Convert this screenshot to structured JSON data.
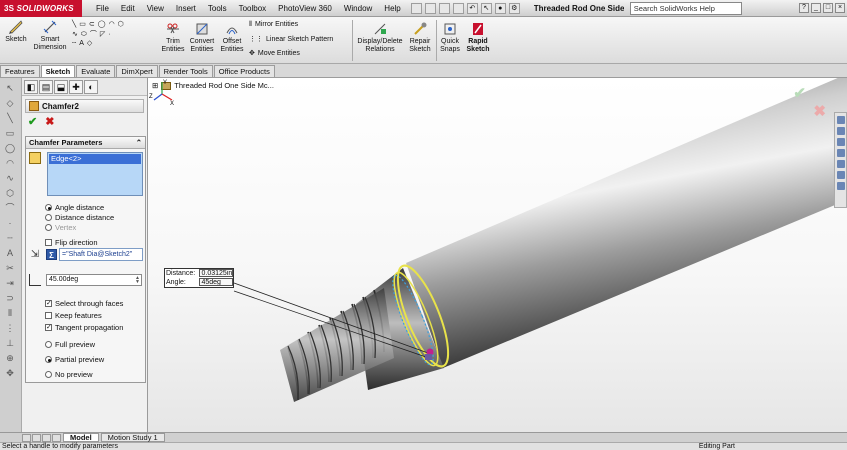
{
  "app": {
    "brand": "SOLIDWORKS",
    "brand_prefix": "3S"
  },
  "menu": [
    "File",
    "Edit",
    "View",
    "Insert",
    "Tools",
    "Toolbox",
    "PhotoView 360",
    "Window",
    "Help"
  ],
  "document_title": "Threaded Rod One Side...",
  "search": {
    "placeholder": "Search SolidWorks Help"
  },
  "ribbon": {
    "sketch": "Sketch",
    "smart_dimension": [
      "Smart",
      "Dimension"
    ],
    "trim_entities": [
      "Trim",
      "Entities"
    ],
    "convert_entities": [
      "Convert",
      "Entities"
    ],
    "offset_entities": [
      "Offset",
      "Entities"
    ],
    "mirror_entities": "Mirror Entities",
    "linear_sketch_pattern": "Linear Sketch Pattern",
    "move_entities": "Move Entities",
    "display_delete_relations": [
      "Display/Delete",
      "Relations"
    ],
    "repair_sketch": [
      "Repair",
      "Sketch"
    ],
    "quick_snaps": [
      "Quick",
      "Snaps"
    ],
    "rapid_sketch": [
      "Rapid",
      "Sketch"
    ]
  },
  "command_tabs": [
    "Features",
    "Sketch",
    "Evaluate",
    "DimXpert",
    "Render Tools",
    "Office Products"
  ],
  "property_manager": {
    "title": "Chamfer2",
    "group_title": "Chamfer Parameters",
    "selected_edge": "Edge<2>",
    "options": {
      "angle_distance": "Angle distance",
      "distance_distance": "Distance distance",
      "vertex": "Vertex",
      "flip_direction": "Flip direction"
    },
    "distance_value": "=\"Shaft Dia@Sketch2\"",
    "angle_value": "45.00deg",
    "checks": {
      "select_through_faces": "Select through faces",
      "keep_features": "Keep features",
      "tangent_propagation": "Tangent propagation"
    },
    "preview": {
      "full": "Full preview",
      "partial": "Partial preview",
      "none": "No preview"
    }
  },
  "viewport": {
    "tree_label": "Threaded Rod One Side Mc...",
    "callout": {
      "distance_label": "Distance:",
      "distance_value": "0.03125in",
      "angle_label": "Angle:",
      "angle_value": "45deg"
    },
    "triad": {
      "x": "X",
      "y": "Y",
      "z": "Z"
    }
  },
  "bottom_tabs": [
    "Model",
    "Motion Study 1"
  ],
  "status": {
    "message": "Select a handle to modify parameters",
    "mode": "Editing Part"
  }
}
